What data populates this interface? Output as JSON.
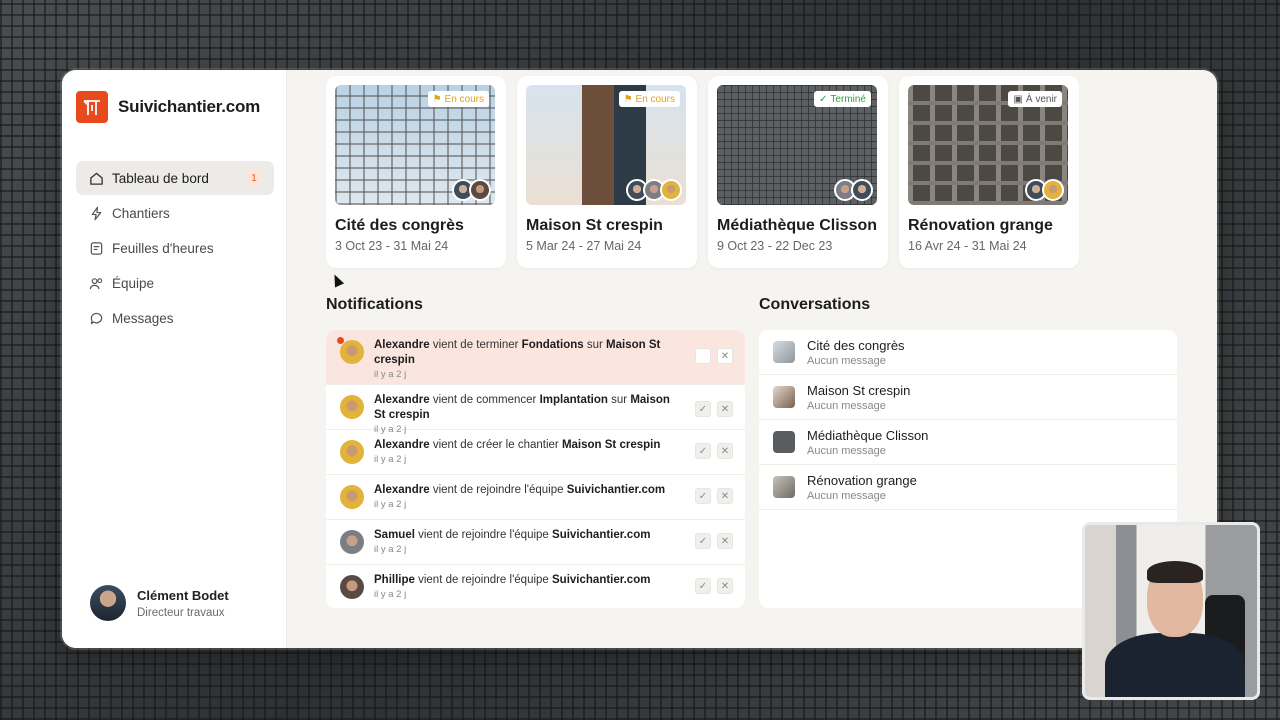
{
  "brand": {
    "name": "Suivichantier.com",
    "logo_icon": "crane-logo-icon",
    "accent": "#e8491d"
  },
  "sidebar": {
    "items": [
      {
        "label": "Tableau de bord",
        "icon": "home-icon",
        "badge": "1",
        "active": true
      },
      {
        "label": "Chantiers",
        "icon": "lightning-icon"
      },
      {
        "label": "Feuilles d'heures",
        "icon": "timesheet-icon"
      },
      {
        "label": "Équipe",
        "icon": "users-icon"
      },
      {
        "label": "Messages",
        "icon": "chat-icon"
      }
    ]
  },
  "user": {
    "name": "Clément Bodet",
    "role": "Directeur travaux"
  },
  "projects": [
    {
      "title": "Cité des congrès",
      "dates": "3 Oct 23 - 31 Mai 24",
      "status": "En cours"
    },
    {
      "title": "Maison St crespin",
      "dates": "5 Mar 24 - 27 Mai 24",
      "status": "En cours"
    },
    {
      "title": "Médiathèque Clisson",
      "dates": "9 Oct 23 - 22 Dec 23",
      "status": "Terminé"
    },
    {
      "title": "Rénovation grange",
      "dates": "16 Avr 24 - 31 Mai 24",
      "status": "À venir"
    }
  ],
  "notifications": {
    "title": "Notifications",
    "items": [
      {
        "actor": "Alexandre",
        "verb": "vient de terminer",
        "object": "Fondations",
        "prep": "sur",
        "target": "Maison St crespin",
        "time": "il y a 2 j",
        "unread": true
      },
      {
        "actor": "Alexandre",
        "verb": "vient de commencer",
        "object": "Implantation",
        "prep": "sur",
        "target": "Maison St crespin",
        "time": "il y a 2 j"
      },
      {
        "actor": "Alexandre",
        "verb": "vient de créer le chantier",
        "object": "",
        "prep": "",
        "target": "Maison St crespin",
        "time": "il y a 2 j"
      },
      {
        "actor": "Alexandre",
        "verb": "vient de rejoindre l'équipe",
        "object": "",
        "prep": "",
        "target": "Suivichantier.com",
        "time": "il y a 2 j"
      },
      {
        "actor": "Samuel",
        "verb": "vient de rejoindre l'équipe",
        "object": "",
        "prep": "",
        "target": "Suivichantier.com",
        "time": "il y a 2 j"
      },
      {
        "actor": "Phillipe",
        "verb": "vient de rejoindre l'équipe",
        "object": "",
        "prep": "",
        "target": "Suivichantier.com",
        "time": "il y a 2 j"
      }
    ]
  },
  "conversations": {
    "title": "Conversations",
    "items": [
      {
        "name": "Cité des congrès",
        "sub": "Aucun message"
      },
      {
        "name": "Maison St crespin",
        "sub": "Aucun message"
      },
      {
        "name": "Médiathèque Clisson",
        "sub": "Aucun message"
      },
      {
        "name": "Rénovation grange",
        "sub": "Aucun message"
      }
    ]
  },
  "colors": {
    "ongoing": "#e0a21c",
    "done": "#2f9e44",
    "unread_bg": "#fbe6df"
  }
}
